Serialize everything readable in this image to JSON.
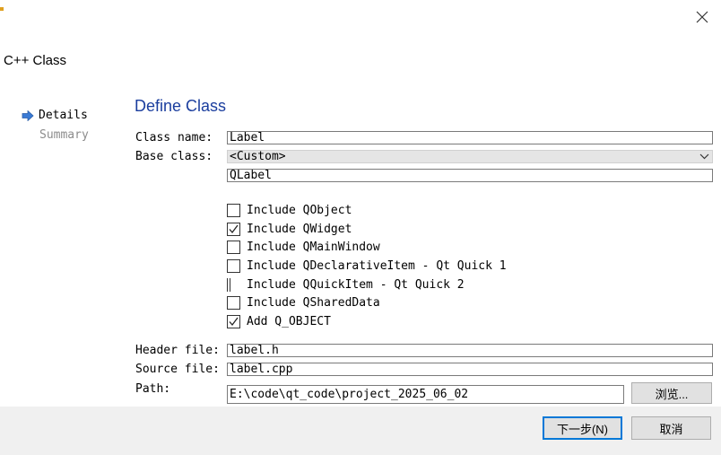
{
  "window": {
    "title": "C++ Class",
    "close_icon": "close-icon"
  },
  "wizard_steps": {
    "current": "Details",
    "other": "Summary",
    "current_icon": "arrow-right-icon"
  },
  "page": {
    "title": "Define Class"
  },
  "form": {
    "class_name_label": "Class name:",
    "class_name_value": "Label",
    "base_class_label": "Base class:",
    "base_class_selected": "<Custom>",
    "base_class_custom_value": "QLabel",
    "header_file_label": "Header file:",
    "header_file_value": "label.h",
    "source_file_label": "Source file:",
    "source_file_value": "label.cpp",
    "path_label": "Path:",
    "path_value": "E:\\code\\qt_code\\project_2025_06_02"
  },
  "checkboxes": [
    {
      "label": "Include QObject",
      "checked": false
    },
    {
      "label": "Include QWidget",
      "checked": true
    },
    {
      "label": "Include QMainWindow",
      "checked": false
    },
    {
      "label": "Include QDeclarativeItem - Qt Quick 1",
      "checked": false
    },
    {
      "label": "Include QQuickItem - Qt Quick 2",
      "checked": false,
      "partially_visible": true
    },
    {
      "label": "Include QSharedData",
      "checked": false
    },
    {
      "label": "Add Q_OBJECT",
      "checked": true
    }
  ],
  "buttons": {
    "browse": "浏览...",
    "next": "下一步(N)",
    "cancel": "取消"
  },
  "colors": {
    "title_blue": "#1b3e9e",
    "arrow_blue": "#3a7bd5",
    "bottom_bar": "#f0f0f0",
    "default_button_border": "#0078d7"
  }
}
